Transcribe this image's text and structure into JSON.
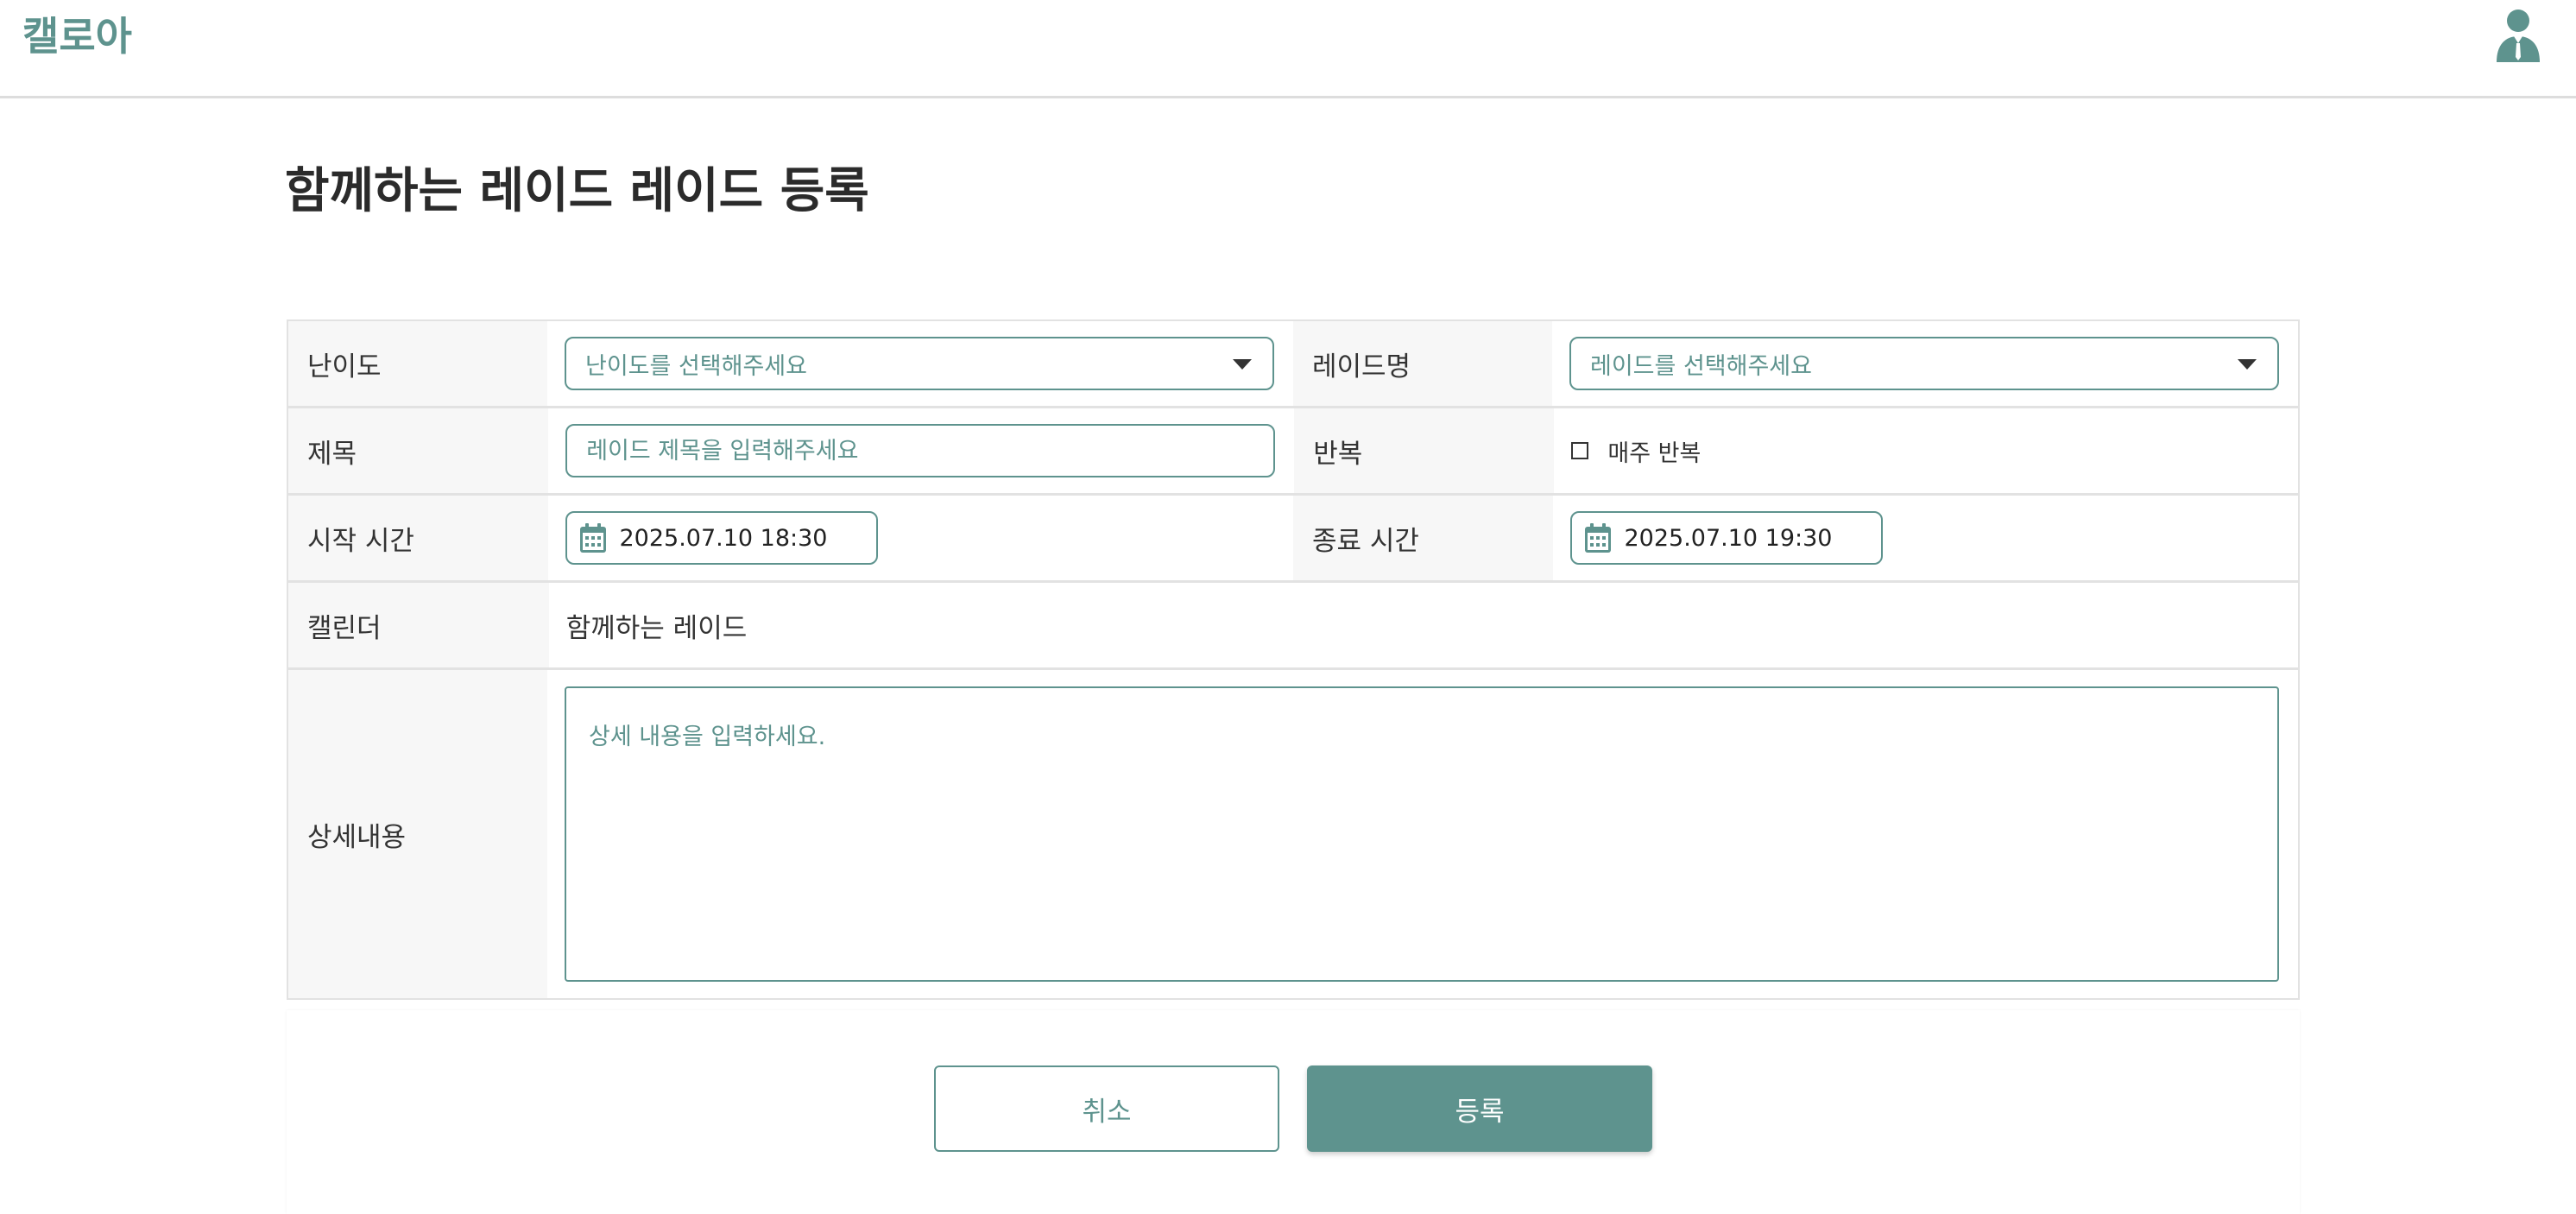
{
  "header": {
    "logo": "캘로아",
    "user_icon": "user-avatar-icon"
  },
  "page": {
    "title": "함께하는 레이드 레이드 등록"
  },
  "form": {
    "difficulty": {
      "label": "난이도",
      "placeholder": "난이도를 선택해주세요"
    },
    "raid_name": {
      "label": "레이드명",
      "placeholder": "레이드를 선택해주세요"
    },
    "title_field": {
      "label": "제목",
      "placeholder": "레이드 제목을 입력해주세요"
    },
    "repeat": {
      "label": "반복",
      "checkbox_label": "매주 반복",
      "checked": false
    },
    "start_time": {
      "label": "시작 시간",
      "value": "2025.07.10 18:30"
    },
    "end_time": {
      "label": "종료 시간",
      "value": "2025.07.10 19:30"
    },
    "calendar": {
      "label": "캘린더",
      "value": "함께하는 레이드"
    },
    "details": {
      "label": "상세내용",
      "placeholder": "상세 내용을 입력하세요."
    }
  },
  "buttons": {
    "cancel": "취소",
    "submit": "등록"
  },
  "colors": {
    "accent": "#5e938e",
    "label_bg": "#f7f7f7",
    "border": "#e2e2e2"
  }
}
